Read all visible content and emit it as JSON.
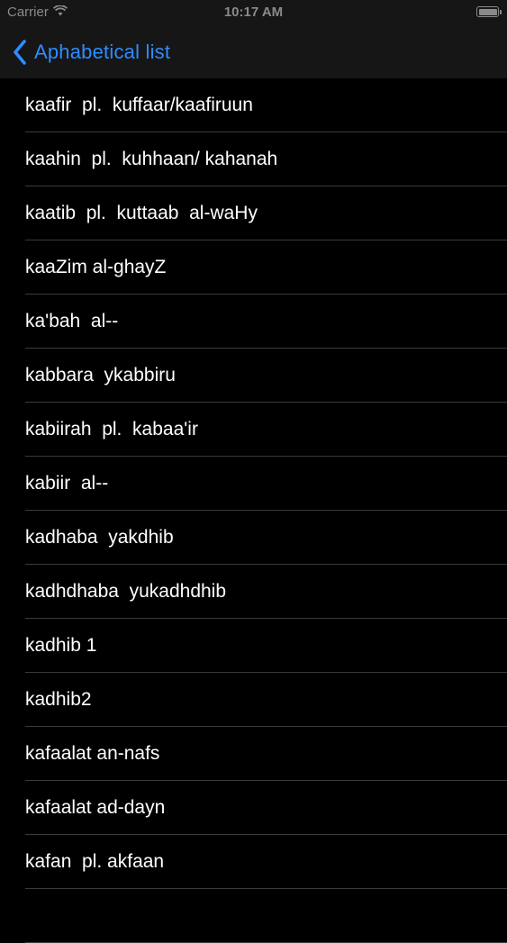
{
  "status_bar": {
    "carrier": "Carrier",
    "time": "10:17 AM",
    "wifi_icon": "wifi-icon",
    "battery_icon": "battery-icon",
    "battery_level": 1.0
  },
  "nav": {
    "back_icon": "chevron-left-icon",
    "back_label": "Aphabetical list"
  },
  "colors": {
    "background": "#000000",
    "bar_background": "#161616",
    "accent": "#2f8cff",
    "separator": "#3a3a3c",
    "status_text": "#8a8a8a"
  },
  "list": {
    "items": [
      {
        "label": "kaafir  pl.  kuffaar/kaafiruun"
      },
      {
        "label": "kaahin  pl.  kuhhaan/ kahanah"
      },
      {
        "label": "kaatib  pl.  kuttaab  al-waHy"
      },
      {
        "label": "kaaZim al-ghayZ"
      },
      {
        "label": "ka'bah  al--"
      },
      {
        "label": "kabbara  ykabbiru"
      },
      {
        "label": "kabiirah  pl.  kabaa'ir"
      },
      {
        "label": "kabiir  al--"
      },
      {
        "label": "kadhaba  yakdhib"
      },
      {
        "label": "kadhdhaba  yukadhdhib"
      },
      {
        "label": "kadhib 1"
      },
      {
        "label": "kadhib2"
      },
      {
        "label": "kafaalat an-nafs"
      },
      {
        "label": "kafaalat ad-dayn"
      },
      {
        "label": "kafan  pl. akfaan"
      },
      {
        "label": ""
      }
    ]
  }
}
